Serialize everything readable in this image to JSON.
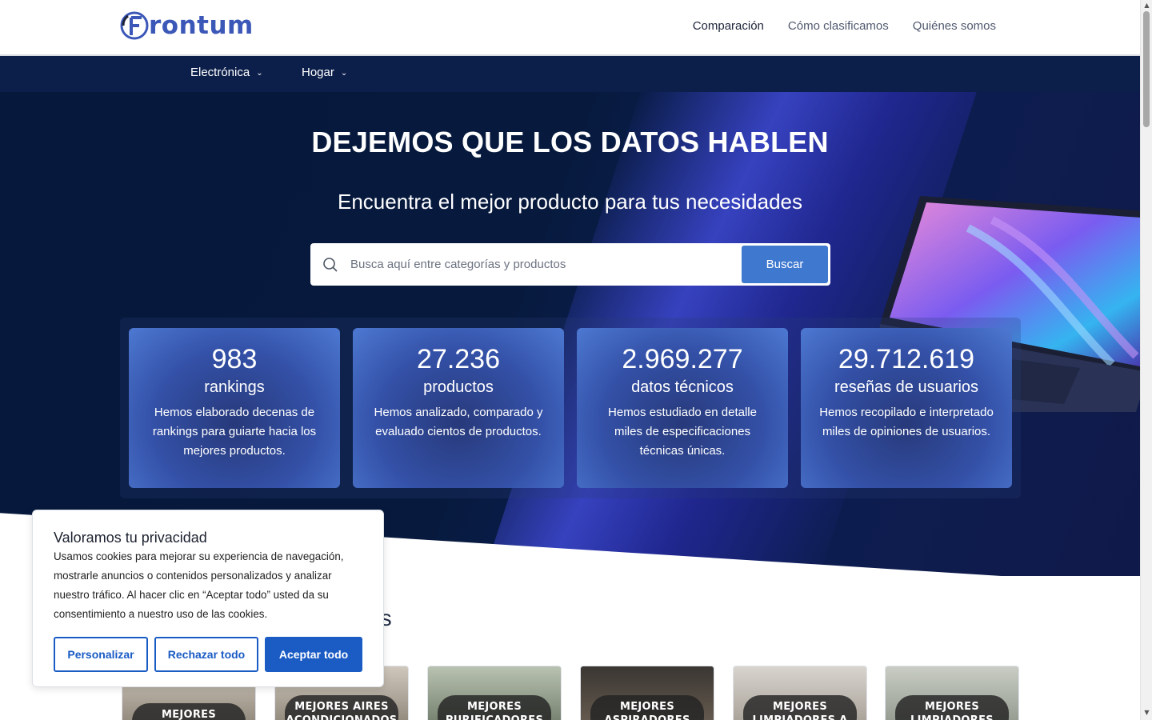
{
  "header": {
    "logo_text": "rontum",
    "nav": [
      {
        "label": "Comparación"
      },
      {
        "label": "Cómo clasificamos"
      },
      {
        "label": "Quiénes somos"
      }
    ]
  },
  "categories": [
    {
      "label": "Electrónica"
    },
    {
      "label": "Hogar"
    }
  ],
  "hero": {
    "title": "DEJEMOS QUE LOS DATOS HABLEN",
    "subtitle": "Encuentra el mejor producto para tus necesidades",
    "search_placeholder": "Busca aquí entre categorías y productos",
    "search_button": "Buscar"
  },
  "stats": [
    {
      "number": "983",
      "label": "rankings",
      "desc": "Hemos elaborado decenas de rankings para guiarte hacia los mejores productos."
    },
    {
      "number": "27.236",
      "label": "productos",
      "desc": "Hemos analizado, comparado y evaluado cientos de productos."
    },
    {
      "number": "2.969.277",
      "label": "datos técnicos",
      "desc": "Hemos estudiado en detalle miles de especificaciones técnicas únicas."
    },
    {
      "number": "29.712.619",
      "label": "reseñas de usuarios",
      "desc": "Hemos recopilado e interpretado miles de opiniones de usuarios."
    }
  ],
  "section": {
    "title_visible": "es"
  },
  "cards": [
    {
      "label": "MEJORES"
    },
    {
      "label": "MEJORES AIRES ACONDICIONADOS"
    },
    {
      "label": "MEJORES PURIFICADORES"
    },
    {
      "label": "MEJORES ASPIRADORES"
    },
    {
      "label": "MEJORES LIMPIADORES A"
    },
    {
      "label": "MEJORES LIMPIADORES"
    }
  ],
  "cookie": {
    "title": "Valoramos tu privacidad",
    "text": "Usamos cookies para mejorar su experiencia de navegación, mostrarle anuncios o contenidos personalizados y analizar nuestro tráfico. Al hacer clic en “Aceptar todo” usted da su consentimiento a nuestro uso de las cookies.",
    "customize": "Personalizar",
    "reject": "Rechazar todo",
    "accept": "Aceptar todo"
  },
  "colors": {
    "brand": "#3b57b8",
    "navy": "#0c1f4a",
    "accent": "#3f78cf",
    "cookie_button": "#1a5bc4"
  }
}
